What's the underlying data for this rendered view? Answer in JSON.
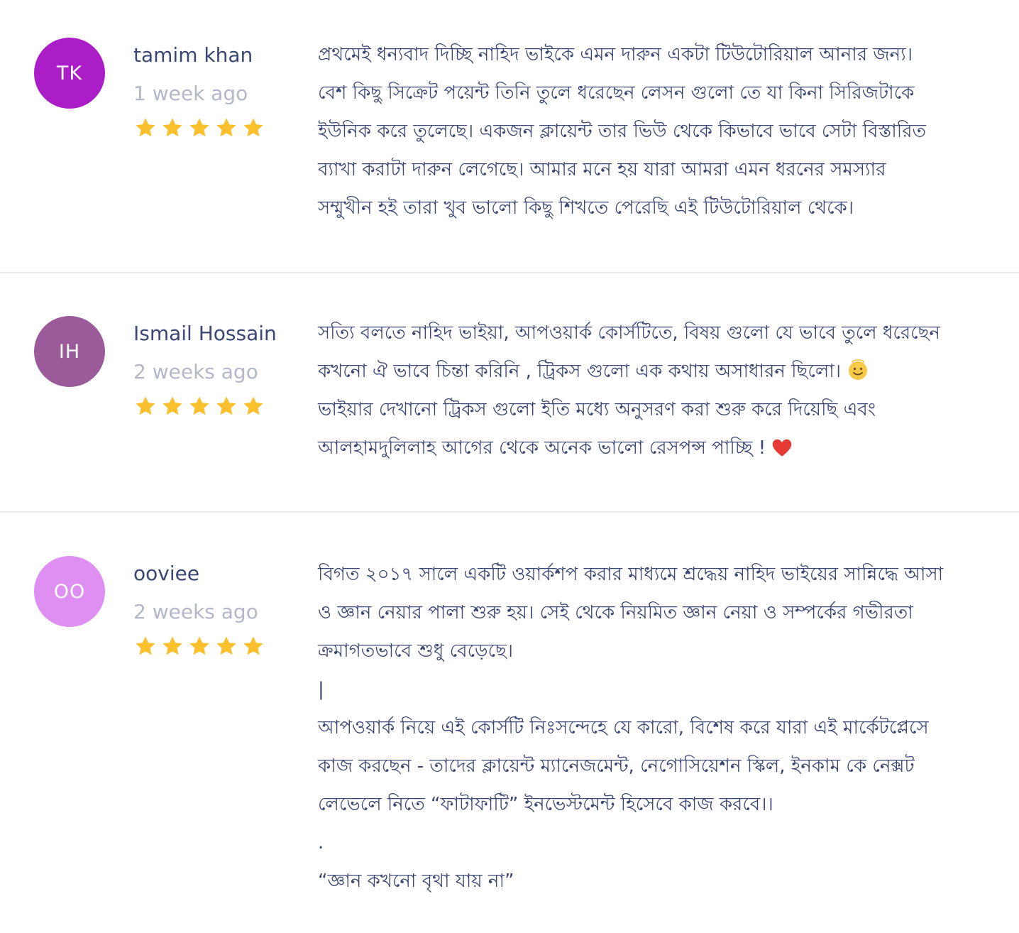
{
  "colors": {
    "text": "#3b4673",
    "muted": "#b3b7c8",
    "star": "#fbc02d",
    "divider": "#ececf0"
  },
  "reviews": [
    {
      "initials": "TK",
      "avatar_color": "#ab1ec7",
      "author": "tamim khan",
      "time": "1 week ago",
      "rating": 5,
      "lines": [
        "প্রথমেই ধন্যবাদ দিচ্ছি নাহিদ ভাইকে এমন দারুন একটা টিউটোরিয়াল আনার জন্য।",
        "বেশ কিছু সিক্রেট পয়েন্ট তিনি তুলে ধরেছেন লেসন গুলো তে যা কিনা সিরিজটাকে",
        "ইউনিক করে তুলেছে। একজন ক্লায়েন্ট তার ভিউ থেকে কিভাবে ভাবে সেটা বিস্তারিত",
        "ব্যাখা করাটা দারুন লেগেছে। আমার মনে হয় যারা আমরা এমন ধরনের সমস্যার",
        "সম্মুখীন হই তারা খুব ভালো কিছু শিখতে পেরেছি এই টিউটোরিয়াল থেকে।"
      ]
    },
    {
      "initials": "IH",
      "avatar_color": "#9b5a9a",
      "author": "Ismail Hossain",
      "time": "2 weeks ago",
      "rating": 5,
      "lines": [
        "সত্যি বলতে নাহিদ ভাইয়া, আপওয়ার্ক কোর্সটিতে, বিষয় গুলো যে ভাবে তুলে ধরেছেন",
        "কখনো ঐ ভাবে চিন্তা করিনি , ট্রিকস গুলো এক কথায় অসাধারন ছিলো।",
        "ভাইয়ার দেখানো ট্রিকস গুলো ইতি মধ্যে অনুসরণ করা শুরু করে দিয়েছি এবং",
        "আলহামদুলিলাহ আগের থেকে অনেক ভালো রেসপন্স পাচ্ছি !"
      ]
    },
    {
      "initials": "OO",
      "avatar_color": "#df8ef2",
      "author": "ooviee",
      "time": "2 weeks ago",
      "rating": 5,
      "lines": [
        "বিগত ২০১৭ সালে একটি ওয়ার্কশপ করার মাধ্যমে শ্রদ্ধেয় নাহিদ ভাইয়ের সান্নিদ্ধে আসা",
        "ও জ্ঞান নেয়ার পালা শুরু হয়। সেই থেকে নিয়মিত জ্ঞান নেয়া ও সম্পর্কের গভীরতা",
        "ক্রমাগতভাবে শুধু বেড়েছে।",
        "|",
        "আপওয়ার্ক নিয়ে এই কোর্সটি নিঃসন্দেহে যে কারো, বিশেষ করে যারা এই মার্কেটপ্লেসে",
        "কাজ করছেন - তাদের ক্লায়েন্ট ম্যানেজমেন্ট, নেগোসিয়েশন স্কিল, ইনকাম কে নেক্সট",
        "লেভেলে নিতে “ফাটাফাটি” ইনভেস্টমেন্ট হিসেবে কাজ করবে।।",
        ".",
        "“জ্ঞান কখনো বৃথা যায় না”"
      ]
    }
  ]
}
